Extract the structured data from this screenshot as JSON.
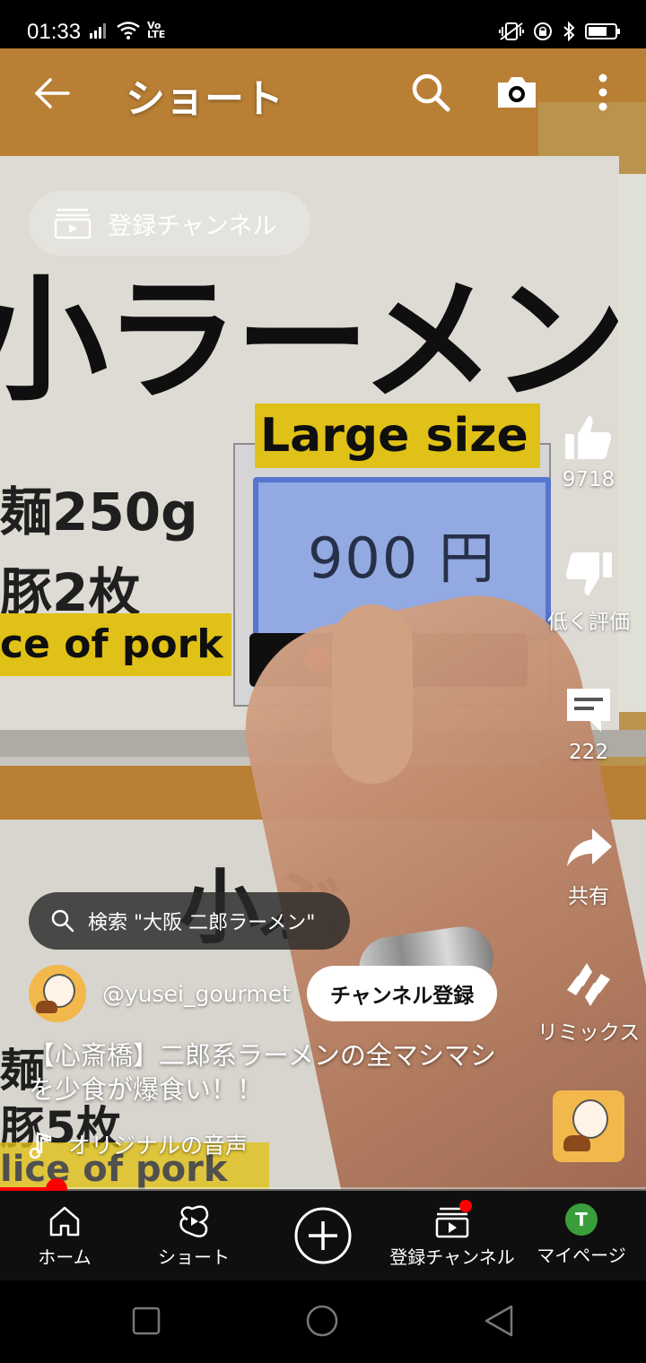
{
  "status_bar": {
    "time": "01:33"
  },
  "header": {
    "title": "ショート"
  },
  "subscriptions_chip": {
    "label": "登録チャンネル"
  },
  "actions": {
    "like_count": "9718",
    "dislike_label": "低く評価",
    "comment_count": "222",
    "share_label": "共有",
    "remix_label": "リミックス"
  },
  "video_overlay": {
    "search_suggestion": "検索 \"大阪 二郎ラーメン\"",
    "channel_handle": "@yusei_gourmet",
    "subscribe_label": "チャンネル登録",
    "title": "【心斎橋】二郎系ラーメンの全マシマシを少食が爆食い！！",
    "audio_label": "オリジナルの音声"
  },
  "video_frame_text": {
    "sign_big": "小ラーメン",
    "large_size": "Large size",
    "price": "900 円",
    "noodle": "麺250g",
    "pork": "豚2枚",
    "pork_en": "ce of pork",
    "noodle2": "麺",
    "pork2": "豚5枚",
    "pork_en2": "lice of pork",
    "partial_jp": "小ぶ"
  },
  "progress": {
    "fraction": 0.087
  },
  "bottom_nav": {
    "home": "ホーム",
    "shorts": "ショート",
    "subscriptions": "登録チャンネル",
    "profile": "マイページ",
    "profile_initial": "T"
  },
  "colors": {
    "accent": "#ff0000",
    "nav_bg": "#0f0f0f"
  }
}
